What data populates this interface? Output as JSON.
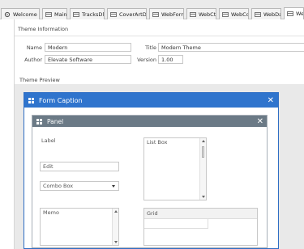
{
  "tabs": [
    {
      "label": "Welcome",
      "icon": "gear-icon",
      "active": false
    },
    {
      "label": "Main",
      "icon": "form-tab-icon",
      "active": false
    },
    {
      "label": "TracksDlg",
      "icon": "form-tab-icon",
      "active": false
    },
    {
      "label": "CoverArtDlg",
      "icon": "form-tab-icon",
      "active": false
    },
    {
      "label": "WebForms",
      "icon": "form-tab-icon",
      "active": false
    },
    {
      "label": "WebCtrls",
      "icon": "form-tab-icon",
      "active": false
    },
    {
      "label": "WebCore",
      "icon": "form-tab-icon",
      "active": false
    },
    {
      "label": "WebData",
      "icon": "form-tab-icon",
      "active": false
    },
    {
      "label": "Web",
      "icon": "form-tab-icon",
      "active": true
    }
  ],
  "theme_info": {
    "section_title": "Theme Information",
    "name_label": "Name",
    "name_value": "Modern",
    "title_label": "Title",
    "title_value": "Modern Theme",
    "author_label": "Author",
    "author_value": "Elevate Software",
    "version_label": "Version",
    "version_value": "1.00"
  },
  "preview": {
    "section_title": "Theme Preview",
    "form_caption": "Form Caption",
    "panel_caption": "Panel",
    "label_text": "Label",
    "edit_text": "Edit",
    "combo_text": "Combo Box",
    "listbox_text": "List Box",
    "memo_text": "Memo",
    "grid_text": "Grid"
  },
  "colors": {
    "form_caption_bg": "#2f74cd",
    "panel_header_bg": "#6b7a86"
  }
}
